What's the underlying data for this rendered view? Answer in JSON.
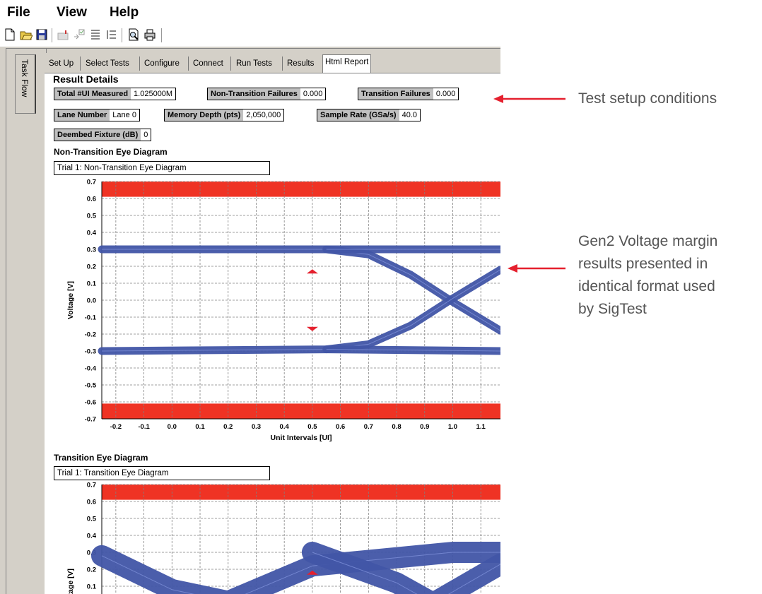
{
  "menu": [
    "File",
    "View",
    "Help"
  ],
  "toolbar_icons": [
    "new-file-icon",
    "open-folder-icon",
    "save-icon",
    "mailbox-icon",
    "checkbox-icon",
    "list-icon",
    "list-indent-icon",
    "print-preview-icon",
    "print-icon"
  ],
  "side_tab": "Task Flow",
  "tabs": [
    "Set Up",
    "Select Tests",
    "Configure",
    "Connect",
    "Run Tests",
    "Results",
    "Html Report"
  ],
  "active_tab": "Html Report",
  "result": {
    "title": "Result Details",
    "fields": [
      {
        "label": "Total #UI Measured",
        "value": "1.025000M"
      },
      {
        "label": "Non-Transition Failures",
        "value": "0.000"
      },
      {
        "label": "Transition Failures",
        "value": "0.000"
      },
      {
        "label": "Lane Number",
        "value": "Lane 0"
      },
      {
        "label": "Memory Depth (pts)",
        "value": "2,050,000"
      },
      {
        "label": "Sample Rate (GSa/s)",
        "value": "40.0"
      },
      {
        "label": "Deembed Fixture (dB)",
        "value": "0"
      }
    ]
  },
  "charts": {
    "non_transition": {
      "section": "Non-Transition Eye Diagram",
      "trial": "Trial 1: Non-Transition Eye Diagram"
    },
    "transition": {
      "section": "Transition Eye Diagram",
      "trial": "Trial 1: Transition Eye Diagram"
    }
  },
  "annotations": {
    "a1": "Test setup conditions",
    "a2": [
      "Gen2 Voltage margin",
      "results presented in",
      "identical format used",
      "by SigTest"
    ]
  },
  "colors": {
    "eye": "#4155a6",
    "mask": "#ef3324",
    "arrow": "#e5202e"
  },
  "chart_data": [
    {
      "type": "line",
      "title": "",
      "xlabel": "Unit Intervals [UI]",
      "ylabel": "Voltage [V]",
      "xlim": [
        -0.25,
        1.17
      ],
      "ylim": [
        -0.7,
        0.7
      ],
      "x_ticks": [
        "-0.2",
        "-0.1",
        "0.0",
        "0.1",
        "0.2",
        "0.3",
        "0.4",
        "0.5",
        "0.6",
        "0.7",
        "0.8",
        "0.9",
        "1.0",
        "1.1"
      ],
      "y_ticks": [
        "0.7",
        "0.6",
        "0.5",
        "0.4",
        "0.3",
        "0.2",
        "0.1",
        "0.0",
        "-0.1",
        "-0.2",
        "-0.3",
        "-0.4",
        "-0.5",
        "-0.6",
        "-0.7"
      ],
      "mask_bands": [
        [
          0.61,
          0.7
        ],
        [
          -0.7,
          -0.61
        ]
      ],
      "mask_markers": [
        {
          "x": 0.5,
          "y": 0.17
        },
        {
          "x": 0.5,
          "y": -0.17
        }
      ],
      "series": [
        {
          "x": [
            -0.25,
            0.55,
            0.7,
            0.85,
            1.0,
            1.17
          ],
          "y": [
            0.3,
            0.3,
            0.27,
            0.15,
            -0.01,
            -0.18
          ]
        },
        {
          "x": [
            -0.25,
            0.55,
            0.7,
            0.85,
            1.0,
            1.17
          ],
          "y": [
            -0.3,
            -0.29,
            -0.26,
            -0.15,
            0.01,
            0.18
          ]
        },
        {
          "x": [
            0.55,
            1.17
          ],
          "y": [
            0.3,
            0.3
          ]
        },
        {
          "x": [
            0.55,
            1.17
          ],
          "y": [
            -0.29,
            -0.3
          ]
        }
      ],
      "grid": true
    },
    {
      "type": "line",
      "title": "",
      "xlabel": "",
      "ylabel": "Voltage [V]",
      "ylim": [
        -0.7,
        0.7
      ],
      "y_ticks": [
        "0.7",
        "0.6",
        "0.5",
        "0.4",
        "0.3",
        "0.2",
        "0.1"
      ],
      "mask_bands": [
        [
          0.61,
          0.7
        ]
      ],
      "mask_markers": [
        {
          "x": 0.5,
          "y": 0.18
        }
      ],
      "series": [
        {
          "x": [
            -0.25,
            0.0,
            0.2,
            0.5,
            1.0,
            1.17
          ],
          "y": [
            0.28,
            0.08,
            0.01,
            0.22,
            0.3,
            0.3
          ]
        },
        {
          "x": [
            0.5,
            0.8,
            0.93,
            1.17
          ],
          "y": [
            0.3,
            0.12,
            0.0,
            0.23
          ]
        }
      ],
      "grid": true
    }
  ]
}
